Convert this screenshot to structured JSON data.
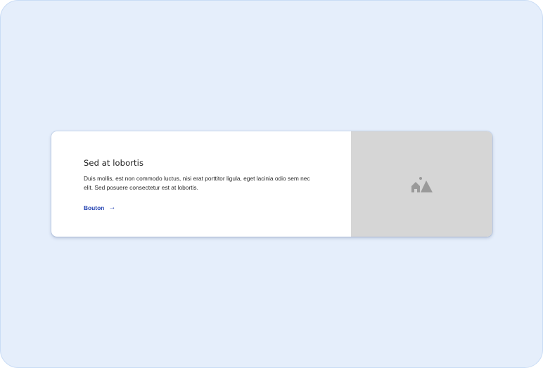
{
  "card": {
    "title": "Sed at lobortis",
    "text": "Duis mollis, est non commodo luctus, nisi erat porttitor ligula, eget lacinia odio sem nec elit. Sed posuere consectetur est at lobortis.",
    "link_label": "Bouton",
    "link_arrow": "→",
    "image_icon": "image-placeholder-icon"
  },
  "colors": {
    "page_background": "#e5eefb",
    "card_background": "#ffffff",
    "media_background": "#d6d6d6",
    "link": "#1f3fb0",
    "icon": "#9a9a9a"
  }
}
